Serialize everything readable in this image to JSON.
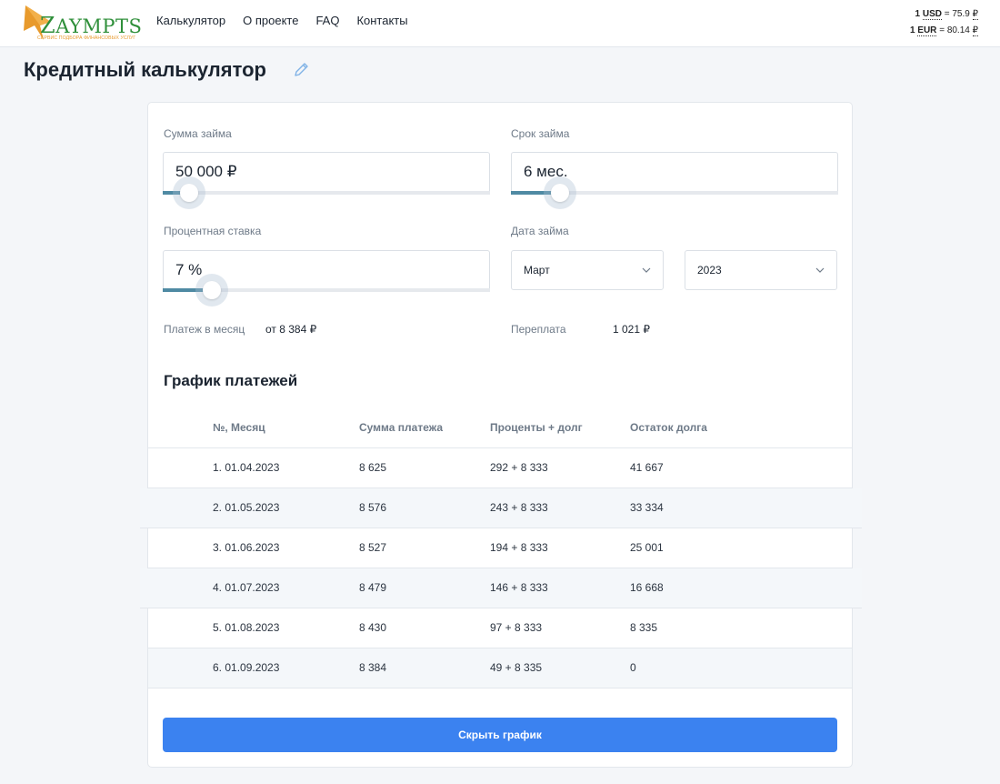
{
  "header": {
    "logo": {
      "text_big": "Z",
      "text_rest": "AYMPTS",
      "subtitle": "СЕРВИС ПОДБОРА ФИНАНСОВЫХ УСЛУГ"
    },
    "nav": [
      {
        "label": "Калькулятор"
      },
      {
        "label": "О проекте"
      },
      {
        "label": "FAQ"
      },
      {
        "label": "Контакты"
      }
    ],
    "rates": {
      "usd": {
        "prefix": "1",
        "cur": "USD",
        "eq": "=",
        "value": "75.9",
        "rub": "₽"
      },
      "eur": {
        "prefix": "1",
        "cur": "EUR",
        "eq": "=",
        "value": "80.14",
        "rub": "₽"
      }
    }
  },
  "page": {
    "title": "Кредитный калькулятор"
  },
  "calculator": {
    "amount": {
      "label": "Сумма займа",
      "value": "50 000 ₽",
      "fill_percent": 8
    },
    "term": {
      "label": "Срок займа",
      "value": "6 мес.",
      "fill_percent": 15
    },
    "rate": {
      "label": "Процентная ставка",
      "value": "7 %",
      "fill_percent": 15
    },
    "date": {
      "label": "Дата займа",
      "month": "Март",
      "year": "2023"
    },
    "monthly": {
      "label": "Платеж в месяц",
      "value": "от 8 384 ₽"
    },
    "overpay": {
      "label": "Переплата",
      "value": "1 021 ₽"
    }
  },
  "schedule": {
    "title": "График платежей",
    "columns": [
      "№, Месяц",
      "Сумма платежа",
      "Проценты + долг",
      "Остаток долга"
    ],
    "rows": [
      [
        "1. 01.04.2023",
        "8 625",
        "292 + 8 333",
        "41 667"
      ],
      [
        "2. 01.05.2023",
        "8 576",
        "243 + 8 333",
        "33 334"
      ],
      [
        "3. 01.06.2023",
        "8 527",
        "194 + 8 333",
        "25 001"
      ],
      [
        "4. 01.07.2023",
        "8 479",
        "146 + 8 333",
        "16 668"
      ],
      [
        "5. 01.08.2023",
        "8 430",
        "97 + 8 333",
        "8 335"
      ],
      [
        "6. 01.09.2023",
        "8 384",
        "49 + 8 335",
        "0"
      ]
    ],
    "hide_button": "Скрыть график"
  },
  "colors": {
    "accent": "#3b82f0",
    "slider": "#4f8aa3",
    "logo_green": "#2f8f3a",
    "logo_orange": "#e89a2c"
  }
}
